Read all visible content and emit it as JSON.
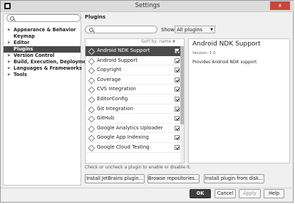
{
  "window": {
    "title": "Settings",
    "close_label": "x"
  },
  "sidebar": {
    "search_placeholder": "",
    "items": [
      {
        "label": "Appearance & Behavior",
        "expandable": true,
        "selected": false
      },
      {
        "label": "Keymap",
        "expandable": false,
        "selected": false
      },
      {
        "label": "Editor",
        "expandable": true,
        "selected": false
      },
      {
        "label": "Plugins",
        "expandable": false,
        "selected": true
      },
      {
        "label": "Version Control",
        "expandable": true,
        "selected": false
      },
      {
        "label": "Build, Execution, Deployment",
        "expandable": true,
        "selected": false
      },
      {
        "label": "Languages & Frameworks",
        "expandable": true,
        "selected": false
      },
      {
        "label": "Tools",
        "expandable": true,
        "selected": false
      }
    ]
  },
  "plugins_page": {
    "title": "Plugins",
    "search_placeholder": "",
    "show_label": "Show:",
    "show_value": "All plugins",
    "sort_label": "Sort by: name",
    "list": [
      {
        "name": "Android NDK Support",
        "checked": true,
        "selected": true
      },
      {
        "name": "Android Support",
        "checked": true,
        "selected": false
      },
      {
        "name": "Copyright",
        "checked": true,
        "selected": false
      },
      {
        "name": "Coverage",
        "checked": true,
        "selected": false
      },
      {
        "name": "CVS Integration",
        "checked": true,
        "selected": false
      },
      {
        "name": "EditorConfig",
        "checked": true,
        "selected": false
      },
      {
        "name": "Git Integration",
        "checked": true,
        "selected": false
      },
      {
        "name": "GitHub",
        "checked": true,
        "selected": false
      },
      {
        "name": "Google Analytics Uploader",
        "checked": true,
        "selected": false
      },
      {
        "name": "Google App Indexing",
        "checked": true,
        "selected": false
      },
      {
        "name": "Google Cloud Testing",
        "checked": true,
        "selected": false
      }
    ],
    "details": {
      "name": "Android NDK Support",
      "version": "Version: 1.0",
      "description": "Provides Android NDK support"
    },
    "hint": "Check or uncheck a plugin to enable or disable it.",
    "install_jetbrains": "Install JetBrains plugin...",
    "browse_repos": "Browse repositories...",
    "install_disk": "Install plugin from disk..."
  },
  "footer": {
    "ok": "OK",
    "cancel": "Cancel",
    "apply": "Apply",
    "help": "Help"
  }
}
